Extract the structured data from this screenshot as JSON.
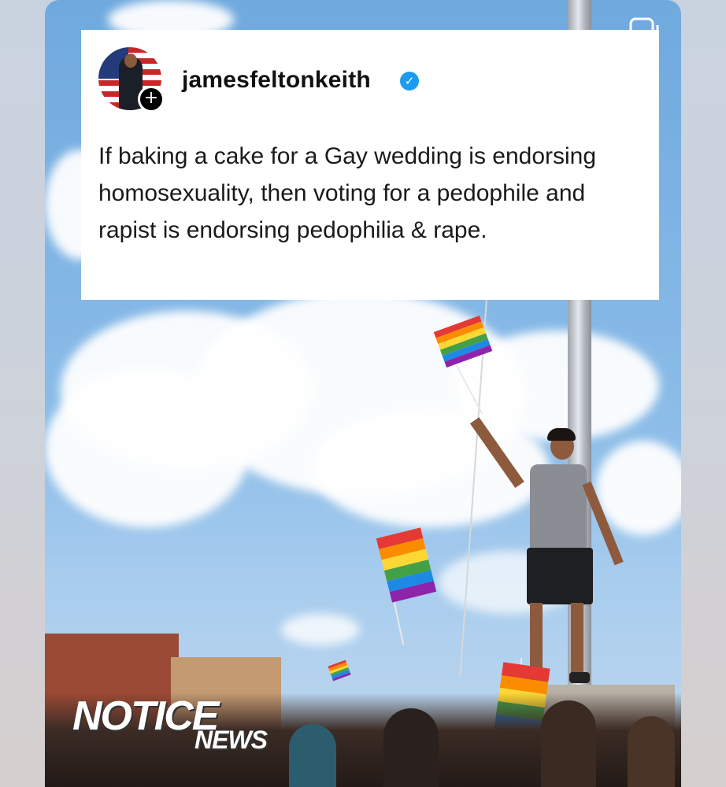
{
  "post": {
    "username": "jamesfeltonkeith",
    "verified": true,
    "text": "If baking a cake for a Gay wedding is endorsing homosexuality, then voting for a pedophile and rapist is endorsing pedophilia & rape."
  },
  "watermark": {
    "line1": "NOTICE",
    "line2": "NEWS"
  },
  "icons": {
    "avatar_badge": "plus-icon",
    "verified": "verified-check-icon",
    "multi_post": "copy-icon"
  },
  "colors": {
    "verified_blue": "#1d9bf0",
    "card_background": "#ffffff",
    "text": "#1a1a1a"
  }
}
